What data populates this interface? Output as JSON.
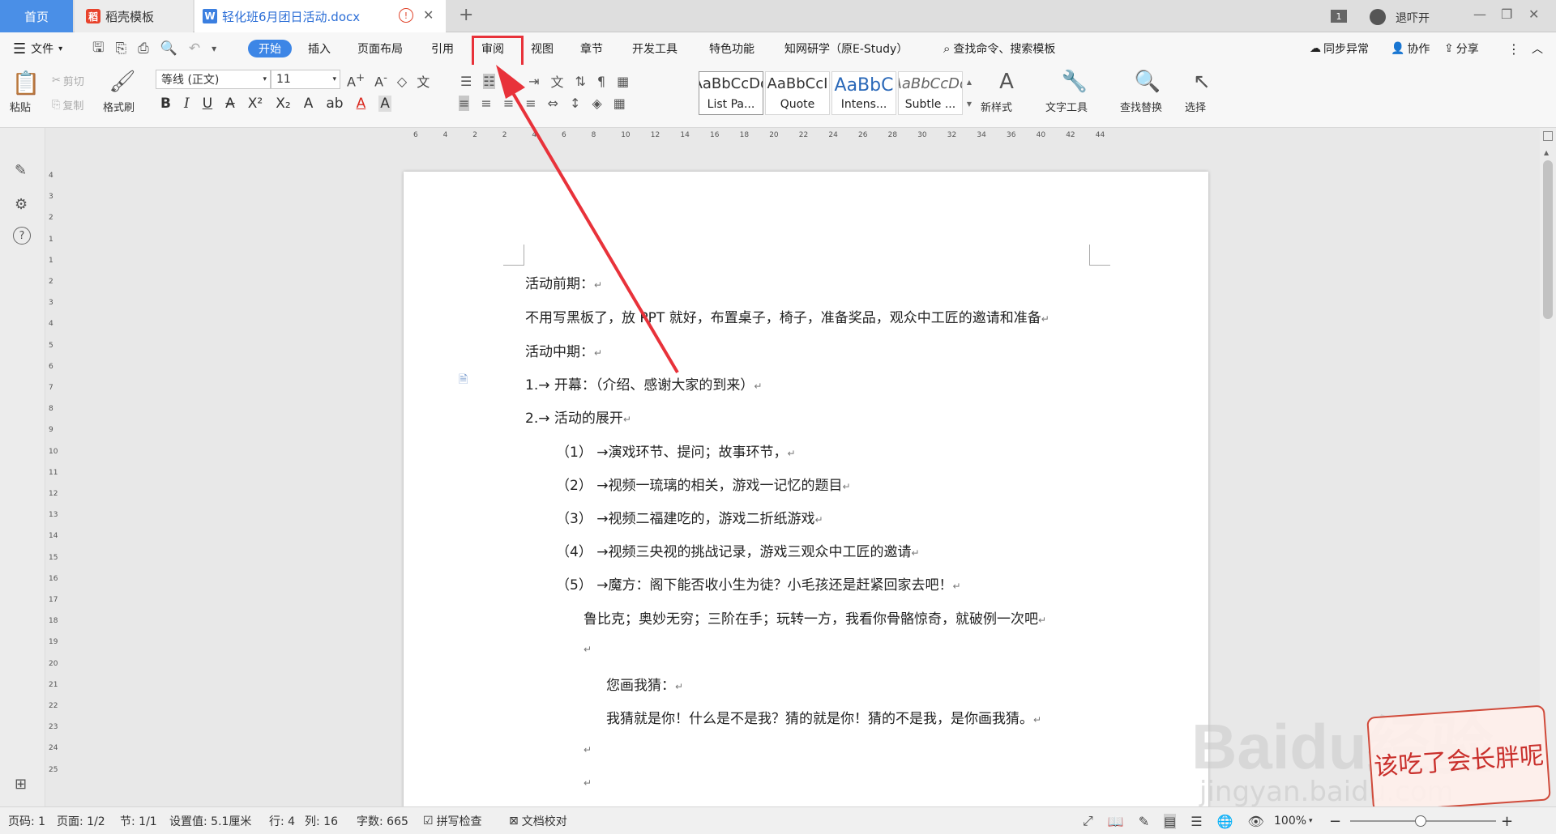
{
  "tabs": {
    "home": "首页",
    "daoke": "稻壳模板",
    "doc": "轻化班6月团日活动.docx",
    "new_tab": "+"
  },
  "window": {
    "count_badge": "1",
    "user": "退吓开",
    "min": "—",
    "restore": "❐",
    "close": "✕"
  },
  "menubar": {
    "file": "文件",
    "items": [
      "开始",
      "插入",
      "页面布局",
      "引用",
      "审阅",
      "视图",
      "章节",
      "开发工具",
      "特色功能",
      "知网研学（原E-Study）"
    ],
    "search_placeholder": "查找命令、搜索模板",
    "sync": "同步异常",
    "collab": "协作",
    "share": "分享"
  },
  "ribbon": {
    "paste": "粘贴",
    "cut": "剪切",
    "copy": "复制",
    "format_painter": "格式刷",
    "font_name": "等线 (正文)",
    "font_size": "11",
    "styles": [
      {
        "preview": "AaBbCcDd",
        "name": "List Pa..."
      },
      {
        "preview": "AaBbCcI",
        "name": "Quote"
      },
      {
        "preview": "AaBbC",
        "name": "Intens..."
      },
      {
        "preview": "AaBbCcDd",
        "name": "Subtle ..."
      }
    ],
    "new_style": "新样式",
    "text_tools": "文字工具",
    "find_replace": "查找替换",
    "select": "选择"
  },
  "ruler_h": [
    "6",
    "4",
    "2",
    "2",
    "4",
    "6",
    "8",
    "10",
    "12",
    "14",
    "16",
    "18",
    "20",
    "22",
    "24",
    "26",
    "28",
    "30",
    "32",
    "34",
    "36",
    "40",
    "42",
    "44"
  ],
  "ruler_v": [
    "4",
    "3",
    "2",
    "1",
    "1",
    "2",
    "3",
    "4",
    "5",
    "6",
    "7",
    "8",
    "9",
    "10",
    "11",
    "12",
    "13",
    "14",
    "15",
    "16",
    "17",
    "18",
    "19",
    "20",
    "21",
    "22",
    "23",
    "24",
    "25"
  ],
  "document": {
    "lines": [
      "活动前期：",
      "不用写黑板了，放 PPT 就好，布置桌子，椅子，准备奖品，观众中工匠的邀请和准备",
      "活动中期：",
      "1.→ 开幕：（介绍、感谢大家的到来）",
      "2.→ 活动的展开",
      "（1）  →演戏环节、提问；故事环节，",
      "（2）  →视频一琉璃的相关，游戏一记忆的题目",
      "（3）  →视频二福建吃的，游戏二折纸游戏",
      "（4）  →视频三央视的挑战记录，游戏三观众中工匠的邀请",
      "（5）  →魔方：阁下能否收小生为徒？小毛孩还是赶紧回家去吧！",
      "鲁比克；奥妙无穷；三阶在手；玩转一方，我看你骨骼惊奇，就破例一次吧",
      "",
      "您画我猜：",
      "我猜就是你！什么是不是我？猜的就是你！猜的不是我，是你画我猜。",
      "",
      ""
    ],
    "para_mark": "↵"
  },
  "status": {
    "page": "页码: 1",
    "pages": "页面: 1/2",
    "section": "节: 1/1",
    "setting": "设置值: 5.1厘米",
    "row": "行: 4",
    "col": "列: 16",
    "words": "字数: 665",
    "spell": "拼写检查",
    "proof": "文档校对",
    "zoom": "100%",
    "minus": "−",
    "plus": "+"
  },
  "watermark": {
    "brand": "Baidu经验",
    "url": "jingyan.baidu.com",
    "sticker": "该吃了会长胖呢"
  },
  "accent": "#3d86e6",
  "highlight": "#e8323a"
}
